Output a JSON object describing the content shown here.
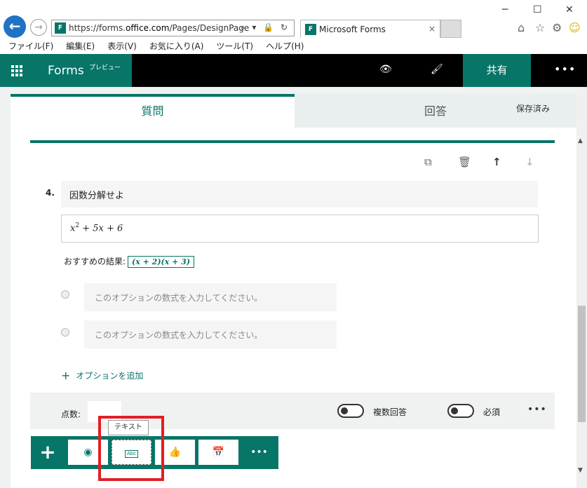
{
  "browser": {
    "url_prefix": "https://forms.",
    "url_domain": "office.com",
    "url_path": "/Pages/DesignPage.aspx",
    "tab_title": "Microsoft Forms",
    "favicon_text": "F",
    "addr_icons": "⌕ ▾ 🔒 ↻",
    "menu": [
      "ファイル(F)",
      "編集(E)",
      "表示(V)",
      "お気に入り(A)",
      "ツール(T)",
      "ヘルプ(H)"
    ]
  },
  "appbar": {
    "title": "Forms",
    "preview": "プレビュー",
    "share": "共有"
  },
  "tabs": {
    "questions": "質問",
    "responses": "回答",
    "saved": "保存済み"
  },
  "question": {
    "number": "4.",
    "title": "因数分解せよ",
    "math_base": "x",
    "math_exp": "2",
    "math_rest": " + 5x + 6",
    "recommended_label": "おすすめの結果:",
    "recommended_value": "(x + 2)(x + 3)",
    "options": [
      "このオプションの数式を入力してください。",
      "このオプションの数式を入力してください。"
    ],
    "add_option": "オプションを追加"
  },
  "footer": {
    "score_label": "点数:",
    "multiple_answers": "複数回答",
    "required": "必須"
  },
  "add_bar": {
    "text_icon_label": "Abc",
    "tooltip": "テキスト"
  }
}
